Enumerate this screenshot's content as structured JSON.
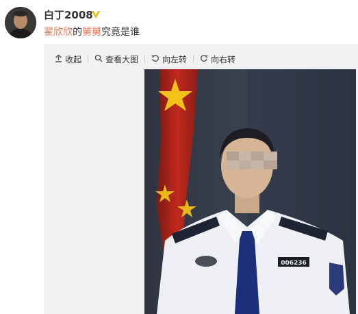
{
  "user": {
    "name": "白丁2008",
    "verified_icon": "verified-v-badge-icon",
    "avatar_icon": "user-avatar"
  },
  "post": {
    "text_parts": [
      "翟欣欣",
      "的",
      "舅舅",
      "究竟是谁"
    ]
  },
  "toolbar": {
    "collapse_label": "收起",
    "view_large_label": "查看大图",
    "rotate_left_label": "向左转",
    "rotate_right_label": "向右转"
  },
  "photo": {
    "badge_number": "006236"
  },
  "colors": {
    "link_orange": "#eb7350",
    "badge_gold": "#f4b400",
    "media_bg": "#f2f2f5"
  }
}
